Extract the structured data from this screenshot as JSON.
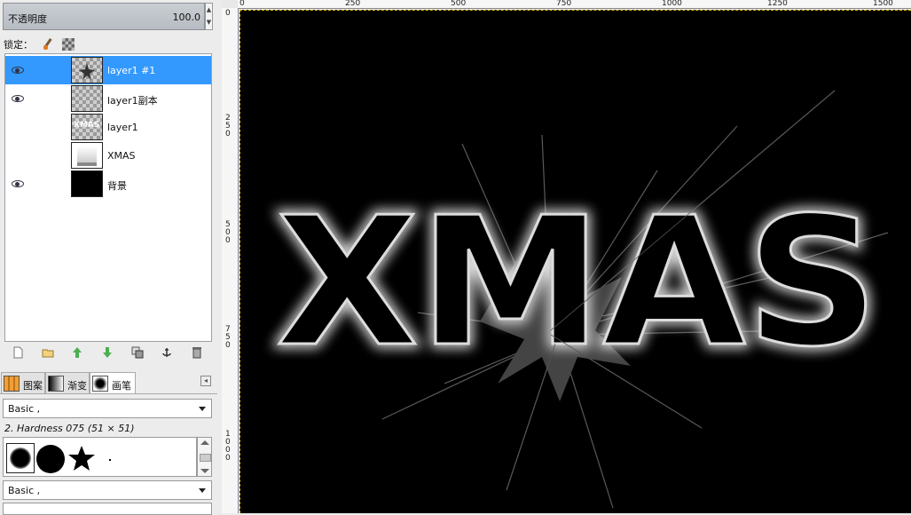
{
  "opacity": {
    "label": "不透明度",
    "value": "100.0"
  },
  "lock": {
    "label": "锁定："
  },
  "layers": [
    {
      "name": "layer1 #1",
      "visible": true,
      "selected": true,
      "thumb": "checker-star"
    },
    {
      "name": "layer1副本",
      "visible": true,
      "selected": false,
      "thumb": "checker"
    },
    {
      "name": "layer1",
      "visible": false,
      "selected": false,
      "thumb": "checker-xmas"
    },
    {
      "name": "XMAS",
      "visible": false,
      "selected": false,
      "thumb": "text-layer"
    },
    {
      "name": "背景",
      "visible": true,
      "selected": false,
      "thumb": "black"
    }
  ],
  "thumb_text": "XMAS",
  "layer_toolbar": [
    "new-layer-icon",
    "new-group-icon",
    "raise-layer-icon",
    "lower-layer-icon",
    "duplicate-layer-icon",
    "anchor-layer-icon",
    "delete-layer-icon"
  ],
  "dock_tabs": [
    {
      "label": "图案",
      "icon": "pattern-icon"
    },
    {
      "label": "渐变",
      "icon": "gradient-icon"
    },
    {
      "label": "画笔",
      "icon": "brush-icon"
    }
  ],
  "brushes": {
    "preset": "Basic ,",
    "selected_name": "2. Hardness 075 (51 × 51)",
    "items": [
      "hardness-075-icon",
      "circle-brush-icon",
      "star-brush-icon",
      "dot-brush-icon"
    ]
  },
  "tool_preset": "Basic ,",
  "ruler": {
    "top_labels": [
      "0",
      "250",
      "500",
      "750",
      "1000",
      "1250",
      "1500"
    ],
    "left_labels": [
      "0",
      "250",
      "500",
      "750",
      "1000"
    ]
  },
  "canvas": {
    "text": "XMAS",
    "background": "#000000",
    "selection_color": "#e6c400"
  },
  "colors": {
    "selected_row": "#3399ff",
    "panel": "#ececec"
  }
}
